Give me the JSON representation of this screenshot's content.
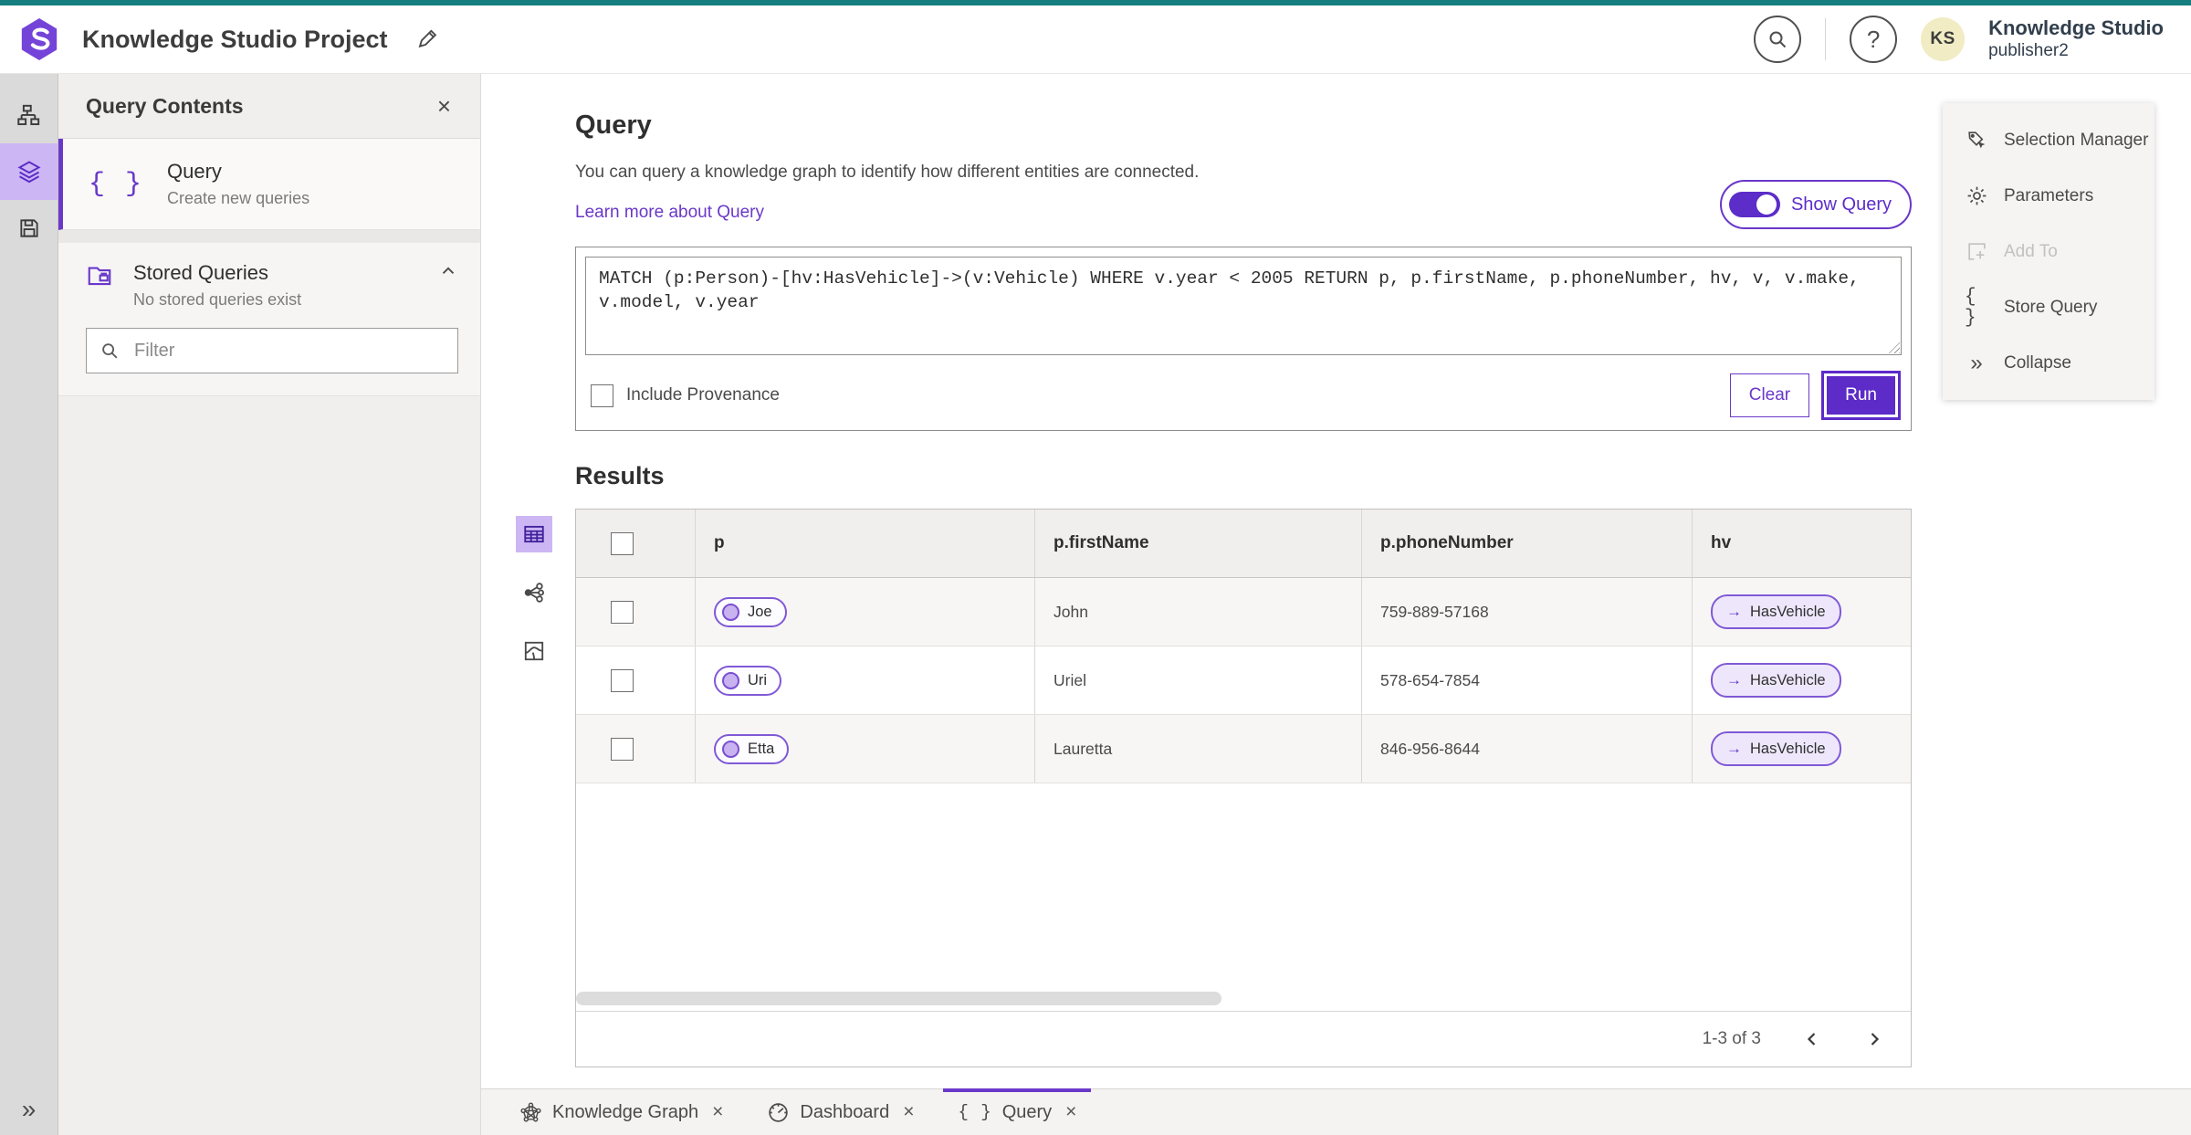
{
  "topbar": {
    "title": "Knowledge Studio Project",
    "product_line1": "Knowledge Studio",
    "product_line2": "publisher2",
    "avatar_initials": "KS",
    "help_glyph": "?"
  },
  "colors": {
    "accent_purple": "#6a38c9",
    "run_button": "#5c2bc8",
    "top_strip_teal": "#157e7e",
    "selected_lavender": "#cdb6f4",
    "avatar_yellow": "#f1ecc3"
  },
  "icons": {
    "braces": "{ }",
    "close": "×",
    "collapse_chevrons": "»",
    "expand_chevrons": "»",
    "rel_arrow": "→"
  },
  "sidebar_panel": {
    "title": "Query Contents",
    "query_item": {
      "title": "Query",
      "subtitle": "Create new queries"
    },
    "stored": {
      "title": "Stored Queries",
      "subtitle": "No stored queries exist"
    },
    "filter_placeholder": "Filter"
  },
  "query_section": {
    "title": "Query",
    "description": "You can query a knowledge graph to identify how different entities are connected.",
    "link": "Learn more about Query",
    "toggle_label": "Show Query",
    "query_text": "MATCH (p:Person)-[hv:HasVehicle]->(v:Vehicle) WHERE v.year < 2005 RETURN p, p.firstName, p.phoneNumber, hv, v, v.make, v.model, v.year",
    "include_provenance_label": "Include Provenance",
    "clear_label": "Clear",
    "run_label": "Run"
  },
  "results": {
    "title": "Results",
    "columns": [
      "p",
      "p.firstName",
      "p.phoneNumber",
      "hv"
    ],
    "rows": [
      {
        "entity": "Joe",
        "firstName": "John",
        "phoneNumber": "759-889-57168",
        "relationship": "HasVehicle"
      },
      {
        "entity": "Uri",
        "firstName": "Uriel",
        "phoneNumber": "578-654-7854",
        "relationship": "HasVehicle"
      },
      {
        "entity": "Etta",
        "firstName": "Lauretta",
        "phoneNumber": "846-956-8644",
        "relationship": "HasVehicle"
      }
    ],
    "pagination": {
      "range": "1-3 of 3"
    }
  },
  "right_panel": {
    "items": [
      {
        "label": "Selection Manager"
      },
      {
        "label": "Parameters"
      },
      {
        "label": "Add To"
      },
      {
        "label": "Store Query"
      },
      {
        "label": "Collapse"
      }
    ]
  },
  "tabs": [
    {
      "label": "Knowledge Graph"
    },
    {
      "label": "Dashboard"
    },
    {
      "label": "Query"
    }
  ]
}
